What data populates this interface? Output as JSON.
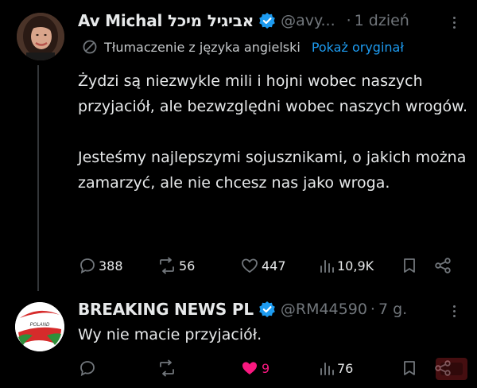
{
  "tweet1": {
    "display_name": "Av Michal אביגיל מיכל",
    "handle": "@avy...",
    "time": "1 dzień",
    "translation_note": "Tłumaczenie z języka angielski",
    "show_original": "Pokaż oryginał",
    "paragraph1": "Żydzi są niezwykle mili i hojni wobec naszych przyjaciół, ale bezwzględni wobec naszych wrogów.",
    "paragraph2": "Jesteśmy najlepszymi sojusznikami, o jakich można zamarzyć, ale nie chcesz nas jako wroga.",
    "replies": "388",
    "reposts": "56",
    "likes": "447",
    "views": "10,9K"
  },
  "tweet2": {
    "display_name": "BREAKING NEWS PL",
    "handle": "@RM44590",
    "time": "7 g.",
    "avatar_label": "POLAND",
    "text": "Wy nie macie przyjaciół.",
    "likes": "9",
    "views": "76"
  },
  "colors": {
    "background": "#000000",
    "text": "#e7e9ea",
    "secondary": "#71767b",
    "link": "#1d9bf0",
    "verified": "#1d9bf0",
    "like_active": "#f91880"
  }
}
